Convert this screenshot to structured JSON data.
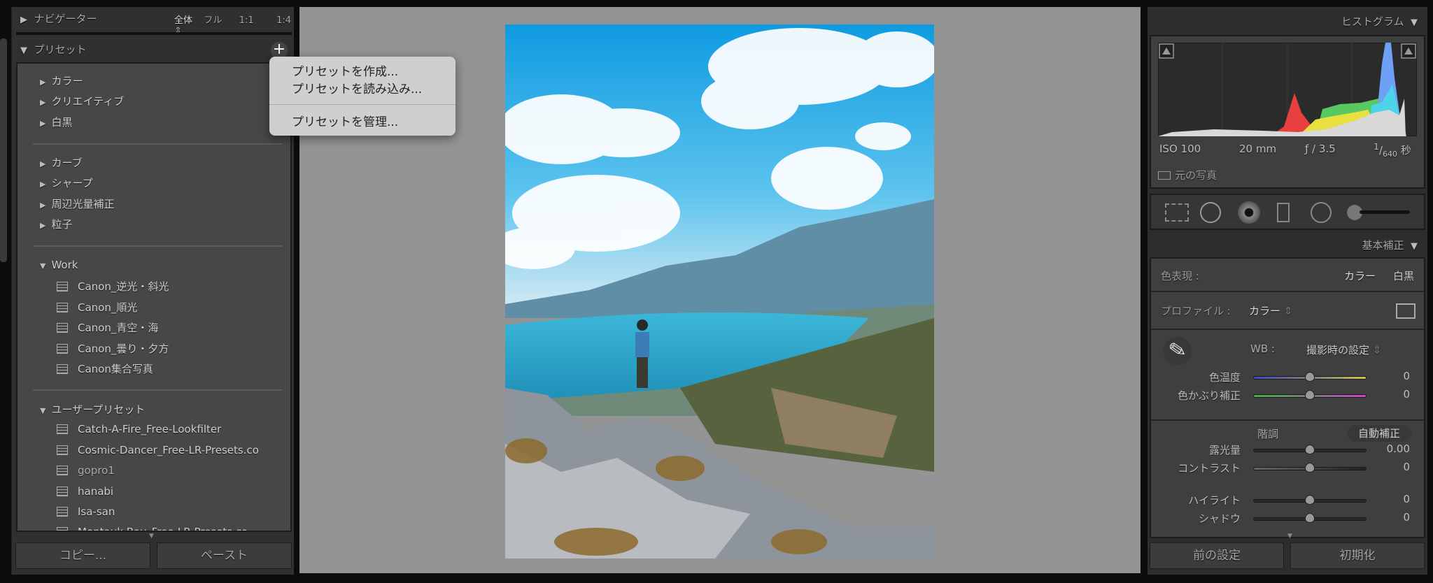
{
  "navigator": {
    "title": "ナビゲーター",
    "zoom_options": [
      "全体",
      "フル",
      "1:1",
      "1:4"
    ]
  },
  "presets": {
    "title": "プリセット",
    "groups_builtin": [
      "カラー",
      "クリエイティブ",
      "白黒"
    ],
    "groups_builtin2": [
      "カーブ",
      "シャープ",
      "周辺光量補正",
      "粒子"
    ],
    "work": {
      "label": "Work",
      "items": [
        "Canon_逆光・斜光",
        "Canon_順光",
        "Canon_青空・海",
        "Canon_曇り・夕方",
        "Canon集合写真"
      ]
    },
    "user": {
      "label": "ユーザープリセット",
      "items": [
        "Catch-A-Fire_Free-Lookfilter",
        "Cosmic-Dancer_Free-LR-Presets.co",
        "gopro1",
        "hanabi",
        "Isa-san",
        "Montauk-Bay_Free-LR-Presets.co"
      ]
    }
  },
  "menu": {
    "items": [
      "プリセットを作成...",
      "プリセットを読み込み...",
      "プリセットを管理..."
    ]
  },
  "left_buttons": {
    "copy": "コピー...",
    "paste": "ペースト"
  },
  "histogram": {
    "title": "ヒストグラム",
    "iso": "ISO 100",
    "focal": "20 mm",
    "aperture": "ƒ / 3.5",
    "shutter_num": "1",
    "shutter_den": "640",
    "shutter_unit": "秒",
    "original_photo": "元の写真"
  },
  "basic": {
    "title": "基本補正",
    "treatment_label": "色表現 :",
    "treatment_color": "カラー",
    "treatment_bw": "白黒",
    "profile_label": "プロファイル :",
    "profile_value": "カラー",
    "wb_label": "WB :",
    "wb_value": "撮影時の設定",
    "tone_label": "階調",
    "auto_button": "自動補正",
    "sliders": [
      {
        "label": "色温度",
        "value": "0",
        "level": 0.5
      },
      {
        "label": "色かぶり補正",
        "value": "0",
        "level": 0.5
      },
      {
        "label": "露光量",
        "value": "0.00",
        "level": 0.5
      },
      {
        "label": "コントラスト",
        "value": "0",
        "level": 0.5
      },
      {
        "label": "ハイライト",
        "value": "0",
        "level": 0.5
      },
      {
        "label": "シャドウ",
        "value": "0",
        "level": 0.5
      }
    ]
  },
  "right_buttons": {
    "previous": "前の設定",
    "reset": "初期化"
  }
}
